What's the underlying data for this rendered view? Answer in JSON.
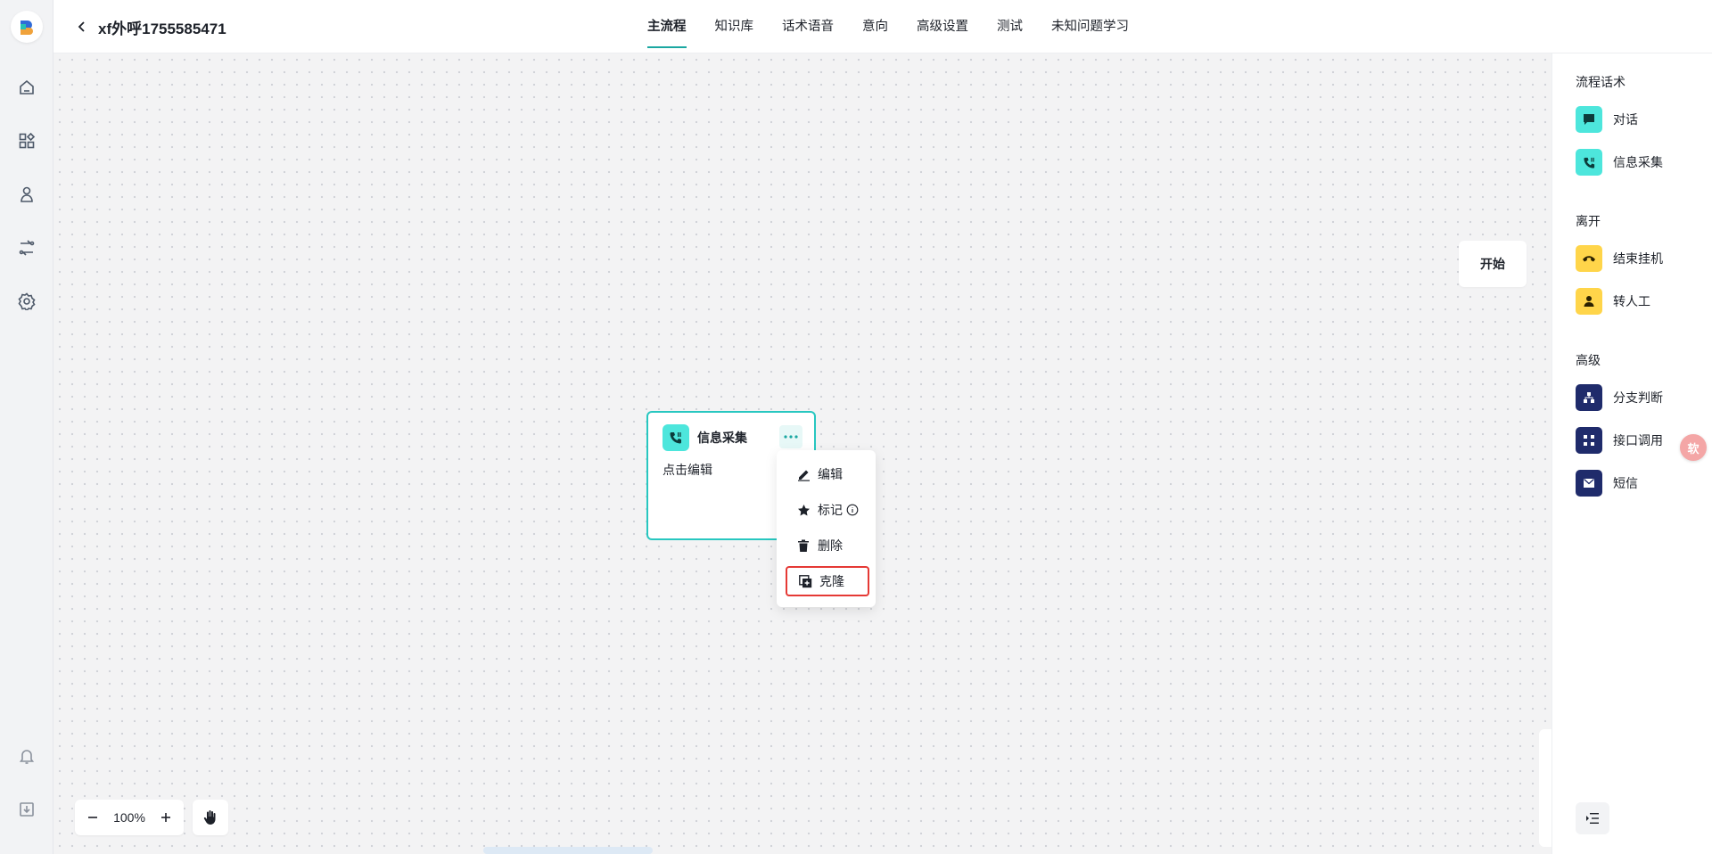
{
  "header": {
    "title": "xf外呼1755585471",
    "tabs": [
      {
        "label": "主流程",
        "active": true
      },
      {
        "label": "知识库"
      },
      {
        "label": "话术语音"
      },
      {
        "label": "意向"
      },
      {
        "label": "高级设置"
      },
      {
        "label": "测试"
      },
      {
        "label": "未知问题学习"
      }
    ]
  },
  "sidebar": {
    "icons": [
      "home-icon",
      "apps-icon",
      "users-icon",
      "flow-icon",
      "settings-icon",
      "bell-icon",
      "download-icon"
    ]
  },
  "canvas": {
    "start_label": "开始",
    "node": {
      "title": "信息采集",
      "body": "点击编辑"
    },
    "context_menu": {
      "items": [
        {
          "label": "编辑",
          "icon": "edit-icon"
        },
        {
          "label": "标记",
          "icon": "star-icon"
        },
        {
          "label": "删除",
          "icon": "trash-icon"
        },
        {
          "label": "克隆",
          "icon": "clone-icon",
          "highlighted": true
        }
      ]
    },
    "zoom": {
      "value": "100%"
    }
  },
  "panel": {
    "sections": [
      {
        "title": "流程话术",
        "items": [
          {
            "label": "对话",
            "color": "#4de6dc",
            "icon": "chat-icon"
          },
          {
            "label": "信息采集",
            "color": "#4de6dc",
            "icon": "phone-icon"
          }
        ]
      },
      {
        "title": "离开",
        "items": [
          {
            "label": "结束挂机",
            "color": "#ffd54a",
            "icon": "hangup-icon"
          },
          {
            "label": "转人工",
            "color": "#ffd54a",
            "icon": "person-icon"
          }
        ]
      },
      {
        "title": "高级",
        "items": [
          {
            "label": "分支判断",
            "color": "#1f2b6b",
            "icon": "branch-icon"
          },
          {
            "label": "接口调用",
            "color": "#1f2b6b",
            "icon": "api-icon"
          },
          {
            "label": "短信",
            "color": "#1f2b6b",
            "icon": "mail-icon"
          }
        ]
      }
    ]
  },
  "floating": {
    "label": "软"
  }
}
